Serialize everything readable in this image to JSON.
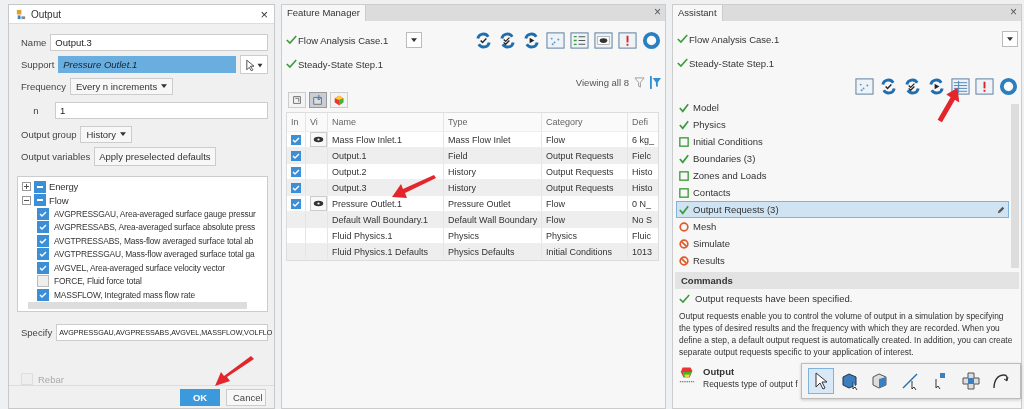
{
  "output_dialog": {
    "title": "Output",
    "close": "×",
    "name": {
      "label": "Name",
      "value": "Output.3"
    },
    "support": {
      "label": "Support",
      "value": "Pressure Outlet.1"
    },
    "frequency": {
      "label": "Frequency",
      "value": "Every n increments"
    },
    "n": {
      "label": "n",
      "value": "1"
    },
    "output_group": {
      "label": "Output group",
      "value": "History"
    },
    "output_variables": {
      "label": "Output variables",
      "button": "Apply preselected defaults"
    },
    "variable_tree": [
      {
        "label": "Energy",
        "expanded": false,
        "partial": true
      },
      {
        "label": "Flow",
        "expanded": true,
        "partial": true,
        "children": [
          {
            "label": "AVGPRESSGAU, Area-averaged surface gauge pressur",
            "checked": true
          },
          {
            "label": "AVGPRESSABS, Area-averaged surface absolute press",
            "checked": true
          },
          {
            "label": "AVGTPRESSABS, Mass-flow averaged surface total ab",
            "checked": true
          },
          {
            "label": "AVGTPRESSGAU, Mass-flow averaged surface total ga",
            "checked": true
          },
          {
            "label": "AVGVEL, Area-averaged surface velocity vector",
            "checked": true
          },
          {
            "label": "FORCE, Fluid force total",
            "checked": false
          },
          {
            "label": "MASSFLOW, Integrated mass flow rate",
            "checked": true
          }
        ]
      }
    ],
    "specify": {
      "label": "Specify",
      "value": "AVGPRESSGAU,AVGPRESSABS,AVGVEL,MASSFLOW,VOLFLO"
    },
    "rebar": {
      "label": "Rebar",
      "checked": false,
      "disabled": true
    },
    "buttons": [
      {
        "label": "OK",
        "primary": true
      },
      {
        "label": "Cancel",
        "primary": false
      }
    ]
  },
  "feature_manager": {
    "title": "Feature Manager",
    "close": "×",
    "case": {
      "label": "Flow Analysis Case.1",
      "done": true
    },
    "step": {
      "label": "Steady-State Step.1",
      "done": true
    },
    "viewing": "Viewing all 8",
    "view_tabs": [
      {
        "selected": false
      },
      {
        "selected": true
      },
      {
        "selected": false
      }
    ],
    "columns": [
      "In",
      "Vi",
      "Name",
      "Type",
      "Category",
      "Defi"
    ],
    "rows": [
      {
        "in": true,
        "visible": true,
        "name": "Mass Flow Inlet.1",
        "type": "Mass Flow Inlet",
        "category": "Flow",
        "column_6": "6 kg_"
      },
      {
        "in": true,
        "visible": false,
        "name": "Output.1",
        "type": "Field",
        "category": "Output Requests",
        "column_6": "Fielc"
      },
      {
        "in": true,
        "visible": false,
        "name": "Output.2",
        "type": "History",
        "category": "Output Requests",
        "column_6": "Histo"
      },
      {
        "in": true,
        "visible": false,
        "name": "Output.3",
        "type": "History",
        "category": "Output Requests",
        "column_6": "Histo"
      },
      {
        "in": true,
        "visible": true,
        "name": "Pressure Outlet.1",
        "type": "Pressure Outlet",
        "category": "Flow",
        "column_6": "0 N_"
      },
      {
        "in": false,
        "visible": false,
        "name": "Default Wall Boundary.1",
        "type": "Default Wall Boundary",
        "category": "Flow",
        "column_6": "No S"
      },
      {
        "in": false,
        "visible": false,
        "name": "Fluid Physics.1",
        "type": "Physics",
        "category": "Physics",
        "column_6": "Fluic"
      },
      {
        "in": false,
        "visible": false,
        "name": "Fluid Physics.1 Defaults",
        "type": "Physics Defaults",
        "category": "Initial Conditions",
        "column_6": "1013"
      }
    ]
  },
  "assistant": {
    "title": "Assistant",
    "close": "×",
    "case": {
      "label": "Flow Analysis Case.1",
      "done": true
    },
    "step": {
      "label": "Steady-State Step.1",
      "done": true
    },
    "steps": [
      {
        "label": "Model",
        "kind": "done",
        "selected": false
      },
      {
        "label": "Physics",
        "kind": "done",
        "selected": false
      },
      {
        "label": "Initial Conditions",
        "kind": "todo",
        "selected": false
      },
      {
        "label": "Boundaries (3)",
        "kind": "done",
        "selected": false
      },
      {
        "label": "Zones and Loads",
        "kind": "todo",
        "selected": false
      },
      {
        "label": "Contacts",
        "kind": "todo",
        "selected": false
      },
      {
        "label": "Output Requests (3)",
        "kind": "done",
        "selected": true
      },
      {
        "label": "Mesh",
        "kind": "required",
        "selected": false
      },
      {
        "label": "Simulate",
        "kind": "blocked",
        "selected": false
      },
      {
        "label": "Results",
        "kind": "blocked",
        "selected": false
      }
    ],
    "commands_title": "Commands",
    "status": "Output requests have been specified.",
    "description": "Output requests enable you to control the volume of output in a simulation by specifying the types of desired results and the frequency with which they are recorded. When you define a step, a default output request is automatically created. In addition, you can create separate output requests specific to your application of interest.",
    "command": {
      "title": "Output",
      "description": "Requests type of output f"
    },
    "selection_tools": [
      {
        "selected": true
      },
      {
        "selected": false
      },
      {
        "selected": false
      },
      {
        "selected": false
      },
      {
        "selected": false
      },
      {
        "selected": false
      },
      {
        "selected": false
      }
    ]
  }
}
